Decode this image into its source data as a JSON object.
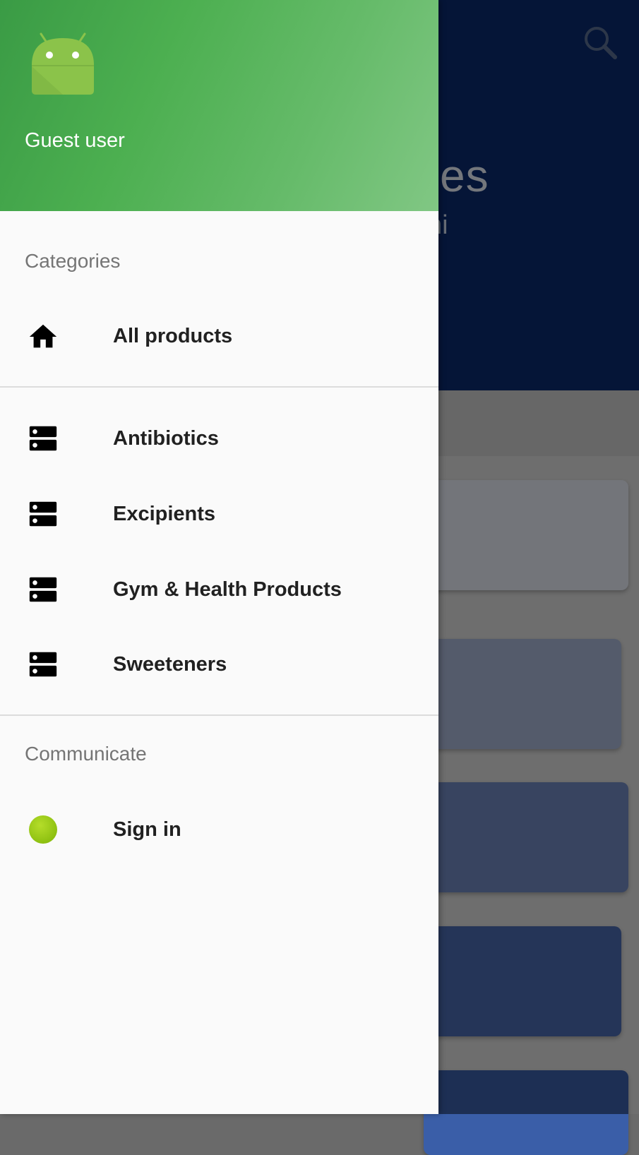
{
  "background": {
    "title_fragment": "ses",
    "subtitle_fragment": "hi",
    "search_icon": "search-icon"
  },
  "drawer": {
    "header": {
      "logo_icon": "android-logo-icon",
      "user_name": "Guest user",
      "gradient_colors": [
        "#3a9b45",
        "#81c784"
      ]
    },
    "categories": {
      "title": "Categories",
      "items": [
        {
          "label": "All products",
          "icon": "home-icon"
        },
        {
          "label": "Antibiotics",
          "icon": "dns-icon"
        },
        {
          "label": "Excipients",
          "icon": "dns-icon"
        },
        {
          "label": "Gym & Health Products",
          "icon": "dns-icon"
        },
        {
          "label": "Sweeteners",
          "icon": "dns-icon"
        }
      ]
    },
    "communicate": {
      "title": "Communicate",
      "items": [
        {
          "label": "Sign in",
          "icon": "status-dot-icon",
          "icon_color": "#9ccc1a"
        }
      ]
    }
  },
  "colors": {
    "app_bar": "#0a2b6e",
    "drawer_bg": "#fafafa",
    "section_title": "#757575"
  }
}
